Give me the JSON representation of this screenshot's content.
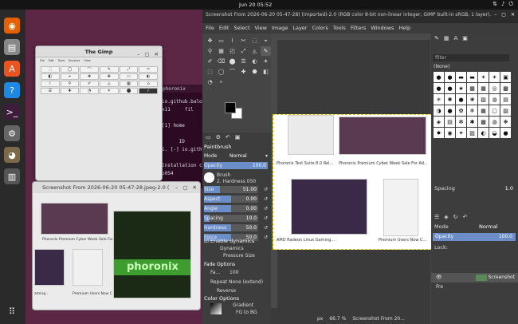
{
  "topbar": {
    "clock": "Jun 20  05:52",
    "tray_icons": [
      "network-icon",
      "volume-icon",
      "power-icon"
    ]
  },
  "dock": {
    "apps": [
      {
        "name": "firefox",
        "glyph": "◉",
        "color": "#e66000"
      },
      {
        "name": "files",
        "glyph": "▤",
        "color": "#888888"
      },
      {
        "name": "app-center",
        "glyph": "A",
        "color": "#e95420"
      },
      {
        "name": "help",
        "glyph": "?",
        "color": "#1e88e5"
      },
      {
        "name": "terminal",
        "glyph": ">_",
        "color": "#3c1e3c"
      },
      {
        "name": "settings",
        "glyph": "⚙",
        "color": "#666666"
      },
      {
        "name": "gimp",
        "glyph": "◕",
        "color": "#7a6a4a"
      },
      {
        "name": "trash",
        "glyph": "▥",
        "color": "#555555"
      }
    ]
  },
  "terminal": {
    "title": "phoronix",
    "lines": [
      "io.github.balo",
      "x11     fil",
      "",
      "[1] home",
      "",
      "      ID",
      "1. [-] io.gith",
      "",
      "Installation c",
      "p0S4"
    ]
  },
  "tgimp": {
    "title": "The Gimp",
    "menu": [
      "File",
      "Edit",
      "Tools",
      "Brushes",
      "View"
    ],
    "tools": [
      "⬚",
      "◯",
      "⌒",
      "✎",
      "⤢",
      "✂",
      "◧",
      "⌖",
      "❖",
      "✥",
      "▭",
      "◐",
      "⌇",
      "⚲",
      "✐",
      "◬",
      "▦",
      "⌂",
      "☰",
      "✚",
      "◔",
      "✶",
      "⬤",
      "✓"
    ],
    "selected_index": 23
  },
  "sw": {
    "title": "Screenshot From 2026-06-20 05-47-28.jpeg-2.0 (",
    "cap1": "Phoronix Premium Cyber Week Sale For Ad",
    "cap2": "Premium Users Now C",
    "cap3": "aming...",
    "big_label": "phoronix"
  },
  "gimp": {
    "title": "Screenshot From 2026-06-20 05-47-28) (imported)-2.0 (RGB color 8-bit non-linear integer, GIMP built-in sRGB, 1 layer)...",
    "menu": [
      "File",
      "Edit",
      "Select",
      "View",
      "Image",
      "Layer",
      "Colors",
      "Tools",
      "Filters",
      "Windows",
      "Help"
    ],
    "tools": [
      "✥",
      "▭",
      "⌇",
      "✂",
      "⬚",
      "⌖",
      "⚲",
      "▦",
      "◰",
      "⤢",
      "◬",
      "✎",
      "✐",
      "⌫",
      "⬤",
      "☰",
      "◐",
      "✶",
      "⬚",
      "◯",
      "⌒",
      "✚",
      "⬣",
      "◧",
      "◔",
      "⚬"
    ],
    "options": {
      "title": "Paintbrush",
      "mode_label": "Mode",
      "mode_value": "Normal",
      "opacity_label": "Opacity",
      "opacity_value": "100.0",
      "opacity_level": 1.0,
      "brush_label": "Brush",
      "brush_value": "2. Hardness 050",
      "sliders": [
        {
          "label": "Size",
          "value": "51.00",
          "level": 0.3
        },
        {
          "label": "Aspect",
          "value": "0.00",
          "level": 0.5
        },
        {
          "label": "Angle",
          "value": "0.00",
          "level": 0.5
        },
        {
          "label": "Spacing",
          "value": "10.0",
          "level": 0.1
        },
        {
          "label": "Hardness",
          "value": "50.0",
          "level": 0.5
        },
        {
          "label": "Force",
          "value": "50.0",
          "level": 0.5
        }
      ],
      "enable_dynamics": "Enable dynamics",
      "dynamics_label": "Dynamics",
      "dynamics_value": "Pressure Size",
      "dynamics_options": "Dynamics Options",
      "fade_options": "Fade Options",
      "fade_label": "Fa...",
      "fade_value": "100",
      "repeat": "Repeat  None (extend)",
      "reverse": "Reverse",
      "color_options": "Color Options",
      "gradient_label": "Gradient",
      "gradient_value": "FG to BG"
    },
    "canvas": {
      "cap1": "Phoronix Test Suite 8.0 Rel...",
      "cap2": "Phoronix Premium Cyber Week Sale For Ad...",
      "cap3": "AMD Radeon Linux Gaming...",
      "cap4": "Premium Users Now C...",
      "big_label": "phoronix"
    },
    "status": {
      "units": "px",
      "zoom": "66.7 %",
      "file": "Screenshot From 20..."
    },
    "right": {
      "filter": "filter",
      "brush_name": "(None)",
      "brushes": [
        "●",
        "●",
        "▬",
        "▬",
        "✶",
        "✶",
        "▣",
        "●",
        "●",
        "★",
        "▦",
        "▦",
        "◎",
        "▩",
        "✳",
        "✺",
        "●",
        "❀",
        "▨",
        "◍",
        "▤",
        "◑",
        "●",
        "✿",
        "❄",
        "▦",
        "▢",
        "▧",
        "◈",
        "▤",
        "✻",
        "✱",
        "▩",
        "◍",
        "❋",
        "✸",
        "◉",
        "✦",
        "▨",
        "◐",
        "◒",
        "●"
      ],
      "spacing_label": "Spacing",
      "spacing_value": "1.0",
      "mode_label": "Mode",
      "mode_value": "Normal",
      "opacity_label": "Opacity",
      "opacity_value": "100.0",
      "lock_label": "Lock:",
      "layer_name": "Screenshot Fro"
    }
  }
}
